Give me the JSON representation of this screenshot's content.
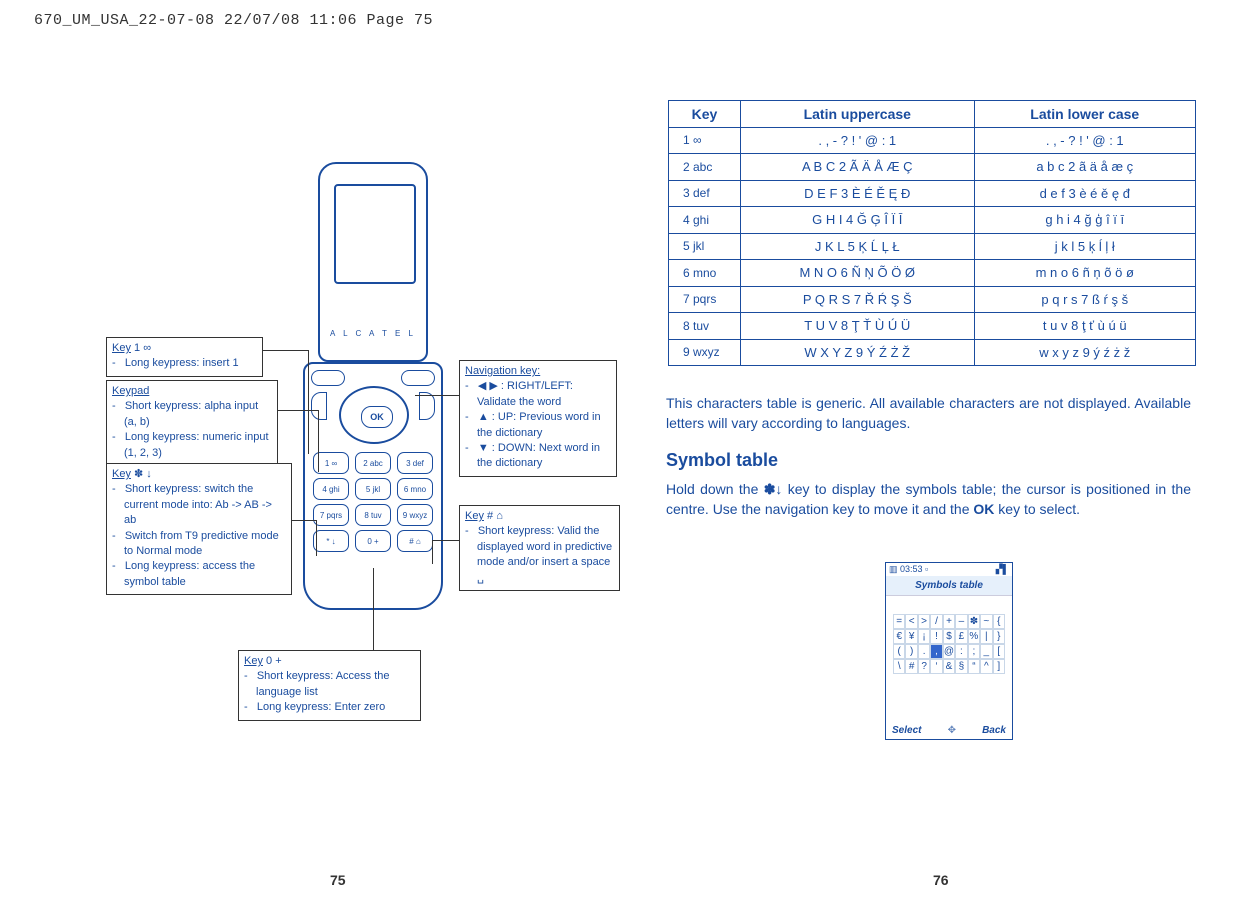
{
  "header_path": "670_UM_USA_22-07-08  22/07/08  11:06  Page 75",
  "page_left_num": "75",
  "page_right_num": "76",
  "phone_brand": "A L C A T E L",
  "keypad_labels": [
    "1 ∞",
    "2 abc",
    "3 def",
    "4 ghi",
    "5 jkl",
    "6 mno",
    "7 pqrs",
    "8 tuv",
    "9 wxyz",
    "* ↓",
    "0 +",
    "# ⌂"
  ],
  "callout_key1": {
    "title": "Key",
    "icon": "1 ∞",
    "items": [
      "Long keypress: insert 1"
    ]
  },
  "callout_keypad": {
    "title": "Keypad",
    "items": [
      "Short keypress: alpha input (a, b)",
      "Long keypress: numeric input (1, 2, 3)"
    ]
  },
  "callout_star": {
    "title": "Key",
    "icon": "✽ ↓",
    "items": [
      "Short keypress: switch the current mode into: Ab -> AB -> ab",
      "Switch from T9 predictive mode to Normal mode",
      "Long keypress: access the symbol table"
    ]
  },
  "callout_zero": {
    "title": "Key",
    "icon": "0 +",
    "items": [
      "Short keypress: Access the language list",
      "Long keypress: Enter zero"
    ]
  },
  "callout_nav": {
    "title": "Navigation key:",
    "items": [
      "◀ ▶ : RIGHT/LEFT: Validate the word",
      "▲ : UP: Previous word in the dictionary",
      "▼ : DOWN: Next word in the dictionary"
    ]
  },
  "callout_hash": {
    "title": "Key",
    "icon": "# ⌂",
    "items": [
      "Short keypress: Valid the displayed word in predictive mode and/or insert a space ␣"
    ]
  },
  "char_table": {
    "headers": [
      "Key",
      "Latin uppercase",
      "Latin lower case"
    ],
    "rows": [
      {
        "key": "1  ∞",
        "upper": ". , - ? ! ' @ : 1",
        "lower": ". , - ? ! ' @ : 1"
      },
      {
        "key": "2 abc",
        "upper": "A B C 2 Ã Ä Å Æ Ç",
        "lower": "a b c 2 ã ä å æ ç"
      },
      {
        "key": "3  def",
        "upper": "D E F 3 È É Ě Ę Đ",
        "lower": "d e f 3 è é ě ę đ"
      },
      {
        "key": "4 ghi",
        "upper": "G H I 4 Ğ Ģ Î Ï Ī",
        "lower": "g h i 4 ğ ģ î ï ī"
      },
      {
        "key": "5  jkl",
        "upper": "J K L 5 Ķ Ĺ Ļ Ł",
        "lower": "j k l 5 ķ ĺ ļ ł"
      },
      {
        "key": "6 mno",
        "upper": "M N O 6 Ñ Ņ Õ Ö Ø",
        "lower": "m n o 6 ñ ņ õ ö ø"
      },
      {
        "key": "7 pqrs",
        "upper": "P Q R S 7 Ř Ŕ Ş Š",
        "lower": "p q r s 7 ß ŕ ş š"
      },
      {
        "key": "8 tuv",
        "upper": "T U V 8 Ţ Ť Ù Ú Ü",
        "lower": "t u v 8 ţ ť ù ú ü"
      },
      {
        "key": "9 wxyz",
        "upper": "W X Y Z 9 Ý Ź Ż Ž",
        "lower": "w x y z 9 ý ź ż ž"
      }
    ]
  },
  "para1": "This characters table is generic. All available characters are not displayed. Available letters will vary according to languages.",
  "heading2": "Symbol table",
  "para2_a": "Hold  down  the  ",
  "para2_icon": "✽↓",
  "para2_b": "  key  to  display  the  symbols  table;  the  cursor  is positioned in the centre. Use the navigation key to move it and the  ",
  "para2_ok": "OK",
  "para2_c": " key to select.",
  "mini": {
    "time": "▥ 03:53 ▫",
    "signal": "▞▌",
    "title": "Symbols table",
    "rows": [
      [
        "=",
        "<",
        ">",
        "/",
        "+",
        "–",
        "✽",
        "~",
        "{"
      ],
      [
        "€",
        "¥",
        "¡",
        "!",
        "$",
        "£",
        "%",
        "|",
        "}"
      ],
      [
        "(",
        ")",
        ".",
        ",",
        "@",
        ":",
        ";",
        "_",
        "["
      ],
      [
        "\\",
        "#",
        "?",
        "‘",
        "&",
        "§",
        "“",
        "^",
        "]"
      ]
    ],
    "highlight": {
      "row": 2,
      "col": 3
    },
    "soft_left": "Select",
    "soft_right": "Back"
  }
}
